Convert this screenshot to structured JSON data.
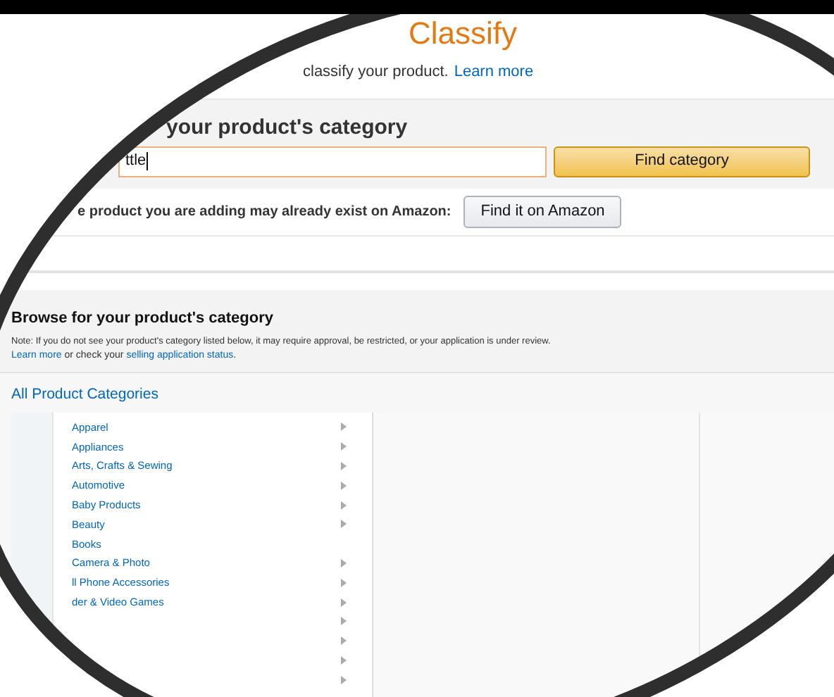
{
  "header": {
    "title": "Classify",
    "subtitle": "classify your product.",
    "link": "Learn more"
  },
  "search": {
    "heading": "your product's category",
    "value": "ttle",
    "button": "Find category"
  },
  "existing": {
    "text": "e product you are adding may already exist on Amazon:",
    "button": "Find it on Amazon"
  },
  "browse": {
    "heading": "Browse for your product's category",
    "note": "Note: If you do not see your product's category listed below, it may require approval, be restricted, or your application is under review.",
    "link1": "Learn more",
    "middle": " or check your ",
    "link2": "selling application status",
    "end": "."
  },
  "categories": {
    "title": "All Product Categories",
    "items": [
      {
        "label": "Apparel",
        "has_children": true
      },
      {
        "label": "Appliances",
        "has_children": true
      },
      {
        "label": "Arts, Crafts & Sewing",
        "has_children": true
      },
      {
        "label": "Automotive",
        "has_children": true
      },
      {
        "label": "Baby Products",
        "has_children": true
      },
      {
        "label": "Beauty",
        "has_children": true
      },
      {
        "label": "Books",
        "has_children": false
      },
      {
        "label": "Camera & Photo",
        "has_children": true
      },
      {
        "label": "ll Phone Accessories",
        "has_children": true
      },
      {
        "label": "der & Video Games",
        "has_children": true
      },
      {
        "has_children": true
      },
      {
        "has_children": true
      },
      {
        "has_children": true
      },
      {
        "has_children": true
      }
    ]
  }
}
